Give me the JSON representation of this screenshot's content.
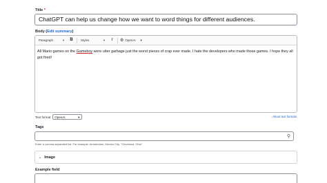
{
  "title_field": {
    "label": "Title",
    "required_mark": "*",
    "value": "ChatGPT can help us change how we want to word things for different audiences."
  },
  "body_field": {
    "label": "Body",
    "summary_open": "(",
    "summary_link": "Edit summary",
    "summary_close": ")",
    "toolbar": {
      "paragraph": "Paragraph",
      "styles": "Styles",
      "bold": "B",
      "italic": "I",
      "ai": "OpenAI"
    },
    "content_before": "All Mario games on the ",
    "content_misspelled": "Gameboy",
    "content_after": " were utter garbage just the worst pieces of crap ever made. I hate the developers who made those games. I hope they all got fired!"
  },
  "text_format": {
    "label": "Text format",
    "selected": "OpenAI",
    "about_link": "About text formats"
  },
  "tags_field": {
    "label": "Tags",
    "help": "Enter a comma-separated list. For example: Amsterdam, Mexico City, \"Cleveland, Ohio\""
  },
  "image_details": {
    "label": "Image"
  },
  "example_field": {
    "label": "Example field"
  }
}
